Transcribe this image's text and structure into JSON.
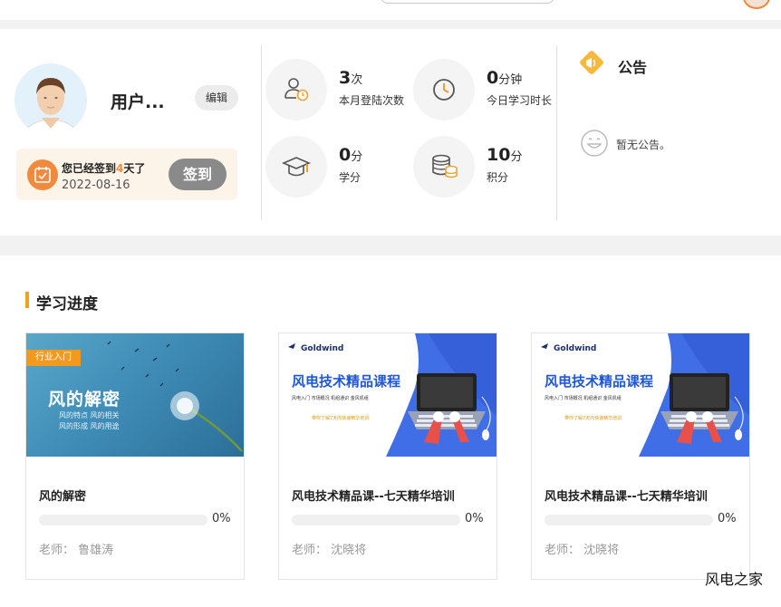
{
  "user": {
    "name": "用户...",
    "edit_label": "编辑"
  },
  "signin": {
    "text_prefix": "您已经签到",
    "days": "4",
    "text_suffix": "天了",
    "date": "2022-08-16",
    "button_label": "签到"
  },
  "stats": [
    {
      "value": "3",
      "unit": "次",
      "label": "本月登陆次数",
      "icon": "user-clock-icon"
    },
    {
      "value": "0",
      "unit": "分钟",
      "label": "今日学习时长",
      "icon": "clock-icon"
    },
    {
      "value": "0",
      "unit": "分",
      "label": "学分",
      "icon": "graduation-cap-icon"
    },
    {
      "value": "10",
      "unit": "分",
      "label": "积分",
      "icon": "coin-stack-icon"
    }
  ],
  "notice": {
    "title": "公告",
    "empty_text": "暂无公告。"
  },
  "progress": {
    "title": "学习进度",
    "courses": [
      {
        "title": "风的解密",
        "percent": 0,
        "percent_label": "0%",
        "teacher": "老师： 鲁雄涛",
        "thumb": {
          "tag": "行业入门",
          "headline": "风的解密",
          "sub_line1": "风的特点  风的相关",
          "sub_line2": "风的形成  风的用途"
        }
      },
      {
        "title": "风电技术精品课--七天精华培训",
        "percent": 0,
        "percent_label": "0%",
        "teacher": "老师： 沈晓将",
        "thumb": {
          "logo": "Goldwind",
          "headline": "风电技术精品课程",
          "tags": "风电入门      市场概况      机组通识      金风机组",
          "sub": "带你了解7天内快速精华培训"
        }
      },
      {
        "title": "风电技术精品课--七天精华培训",
        "percent": 0,
        "percent_label": "0%",
        "teacher": "老师： 沈晓将",
        "thumb": {
          "logo": "Goldwind",
          "headline": "风电技术精品课程",
          "tags": "风电入门      市场概况      机组通识      金风机组",
          "sub": "带你了解7天内快速精华培训"
        }
      }
    ]
  },
  "watermark": "风电之家",
  "colors": {
    "accent": "#f3a11a",
    "signin_orange": "#f08a3c",
    "signin_bg": "#fdf4e9",
    "button_gray": "#8a8a8a",
    "course_blue": "#1f57d6"
  }
}
